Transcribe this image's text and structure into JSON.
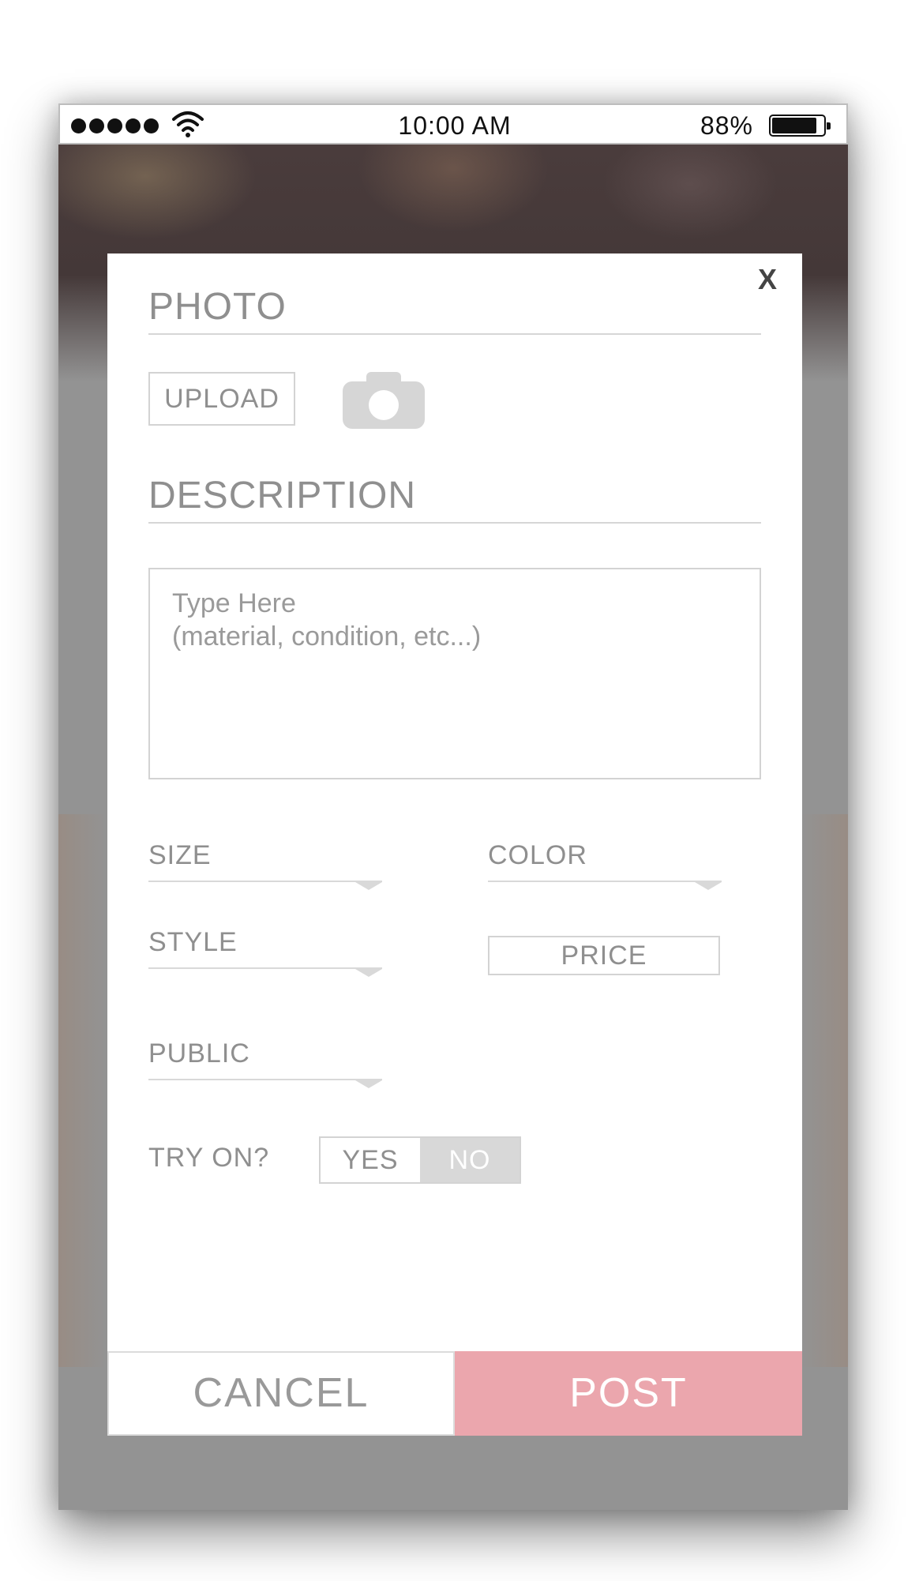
{
  "status_bar": {
    "time": "10:00 AM",
    "battery_percent_label": "88%",
    "battery_level": 0.88,
    "signal_bars": 5
  },
  "modal": {
    "close_label": "X",
    "photo": {
      "title": "PHOTO",
      "upload_label": "UPLOAD"
    },
    "description": {
      "title": "DESCRIPTION",
      "placeholder_line1": "Type Here",
      "placeholder_line2": "(material, condition, etc...)"
    },
    "fields": {
      "size": "SIZE",
      "color": "COLOR",
      "style": "STYLE",
      "price": "PRICE",
      "public": "PUBLIC"
    },
    "try_on": {
      "label": "TRY ON?",
      "yes": "YES",
      "no": "NO",
      "selected": "NO"
    },
    "footer": {
      "cancel": "CANCEL",
      "post": "POST"
    }
  },
  "colors": {
    "post_button": "#eba6ad",
    "toggle_selected": "#d8d8d8",
    "label_text": "#8f8f8f"
  },
  "icons": [
    "signal-dots-icon",
    "wifi-icon",
    "battery-icon",
    "close-icon",
    "camera-icon",
    "caret-down-icon"
  ]
}
